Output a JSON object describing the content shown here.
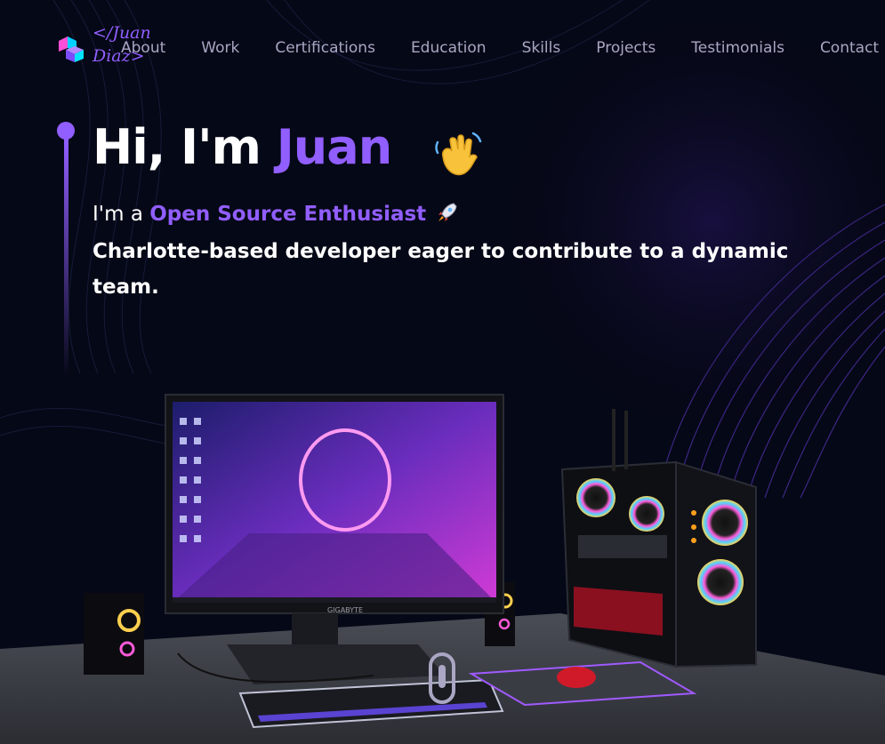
{
  "brand": {
    "logo_line1": "</Juan",
    "logo_line2": "Diaz>"
  },
  "nav": {
    "items": [
      "About",
      "Work",
      "Certifications",
      "Education",
      "Skills",
      "Projects",
      "Testimonials",
      "Contact"
    ]
  },
  "hero": {
    "greeting": "Hi, I'm ",
    "name": "Juan",
    "role_prefix": "I'm a ",
    "role": "Open Source Enthusiast",
    "tagline": "Charlotte-based developer eager to contribute to a dynamic team."
  },
  "monitor": {
    "brand": "GIGABYTE"
  },
  "colors": {
    "accent": "#915eff",
    "background": "#050816",
    "nav_text": "#aaa6c3"
  },
  "icons": [
    "logo-cube-icon",
    "waving-hand-icon",
    "rocket-icon",
    "scroll-indicator-icon"
  ]
}
